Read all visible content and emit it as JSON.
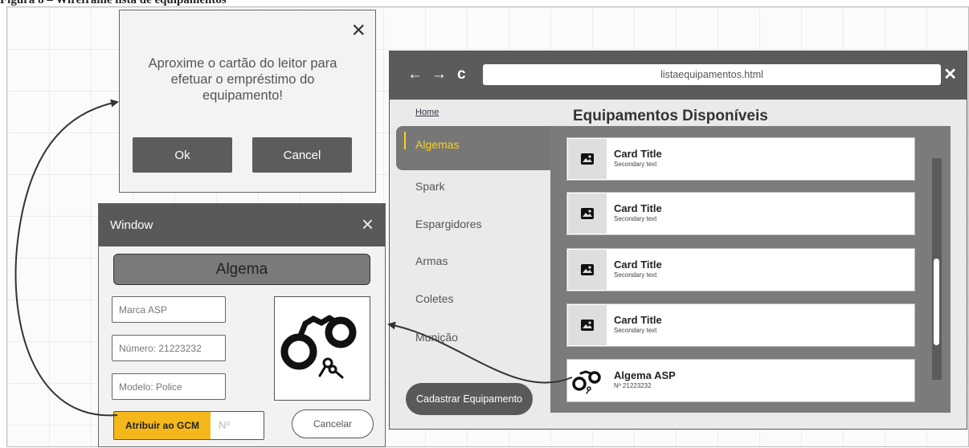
{
  "caption": "Figura 8 – Wireframe lista de equipamentos",
  "dialog": {
    "message": "Aproxime o cartão do leitor para efetuar o empréstimo do equipamento!",
    "ok_label": "Ok",
    "cancel_label": "Cancel",
    "close_icon": "×"
  },
  "window": {
    "title": "Window",
    "close_icon": "×",
    "equipment_name": "Algema",
    "fields": {
      "marca": "Marca ASP",
      "numero": "Número: 21223232",
      "modelo": "Modelo: Police"
    },
    "image_icon": "handcuffs-icon",
    "assign_label": "Atribuir ao GCM",
    "assign_placeholder": "Nº",
    "cancel_label": "Cancelar"
  },
  "browser": {
    "back_icon": "←",
    "forward_icon": "→",
    "reload_icon": "c",
    "url": "listaequipamentos.html",
    "close_icon": "✕",
    "home_link": "Home",
    "page_title": "Equipamentos Disponíveis",
    "sidebar": {
      "active": "Algemas",
      "items": [
        "Spark",
        "Espargidores",
        "Armas",
        "Coletes",
        "Munição"
      ],
      "register_button": "Cadastrar Equipamento"
    },
    "cards": [
      {
        "title": "Card Title",
        "subtitle": "Secondary text",
        "icon": "image-placeholder-icon"
      },
      {
        "title": "Card Title",
        "subtitle": "Secondary text",
        "icon": "image-placeholder-icon"
      },
      {
        "title": "Card Title",
        "subtitle": "Secondary text",
        "icon": "image-placeholder-icon"
      },
      {
        "title": "Card Title",
        "subtitle": "Secondary text",
        "icon": "image-placeholder-icon"
      },
      {
        "title": "Algema ASP",
        "subtitle": "Nº 21223232",
        "icon": "handcuffs-icon"
      }
    ]
  },
  "colors": {
    "accent_yellow": "#f5b81c",
    "dark_gray": "#595959",
    "mid_gray": "#7b7b7b"
  }
}
